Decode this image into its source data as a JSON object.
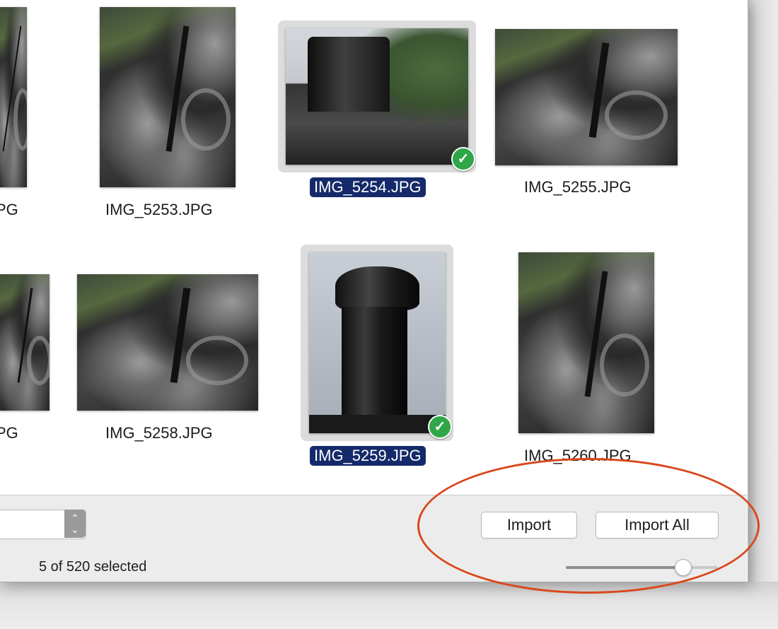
{
  "photos": [
    {
      "filename": "IMG_5253.JPG",
      "selected": false
    },
    {
      "filename": "IMG_5254.JPG",
      "selected": true
    },
    {
      "filename": "IMG_5255.JPG",
      "selected": false
    },
    {
      "filename": "IMG_5258.JPG",
      "selected": false
    },
    {
      "filename": "IMG_5259.JPG",
      "selected": true
    },
    {
      "filename": "IMG_5260.JPG",
      "selected": false
    }
  ],
  "partial_labels": {
    "row1": "PG",
    "row2": "PG"
  },
  "bottombar": {
    "status": "5 of 520 selected",
    "import_label": "Import",
    "import_all_label": "Import All",
    "zoom_fraction": 0.77
  },
  "colors": {
    "selection_label": "#152a6a",
    "check": "#2fa648",
    "annotation": "#d9481c"
  },
  "icons": {
    "check": "checkmark-icon",
    "stepper": "chevron-updown-icon"
  }
}
